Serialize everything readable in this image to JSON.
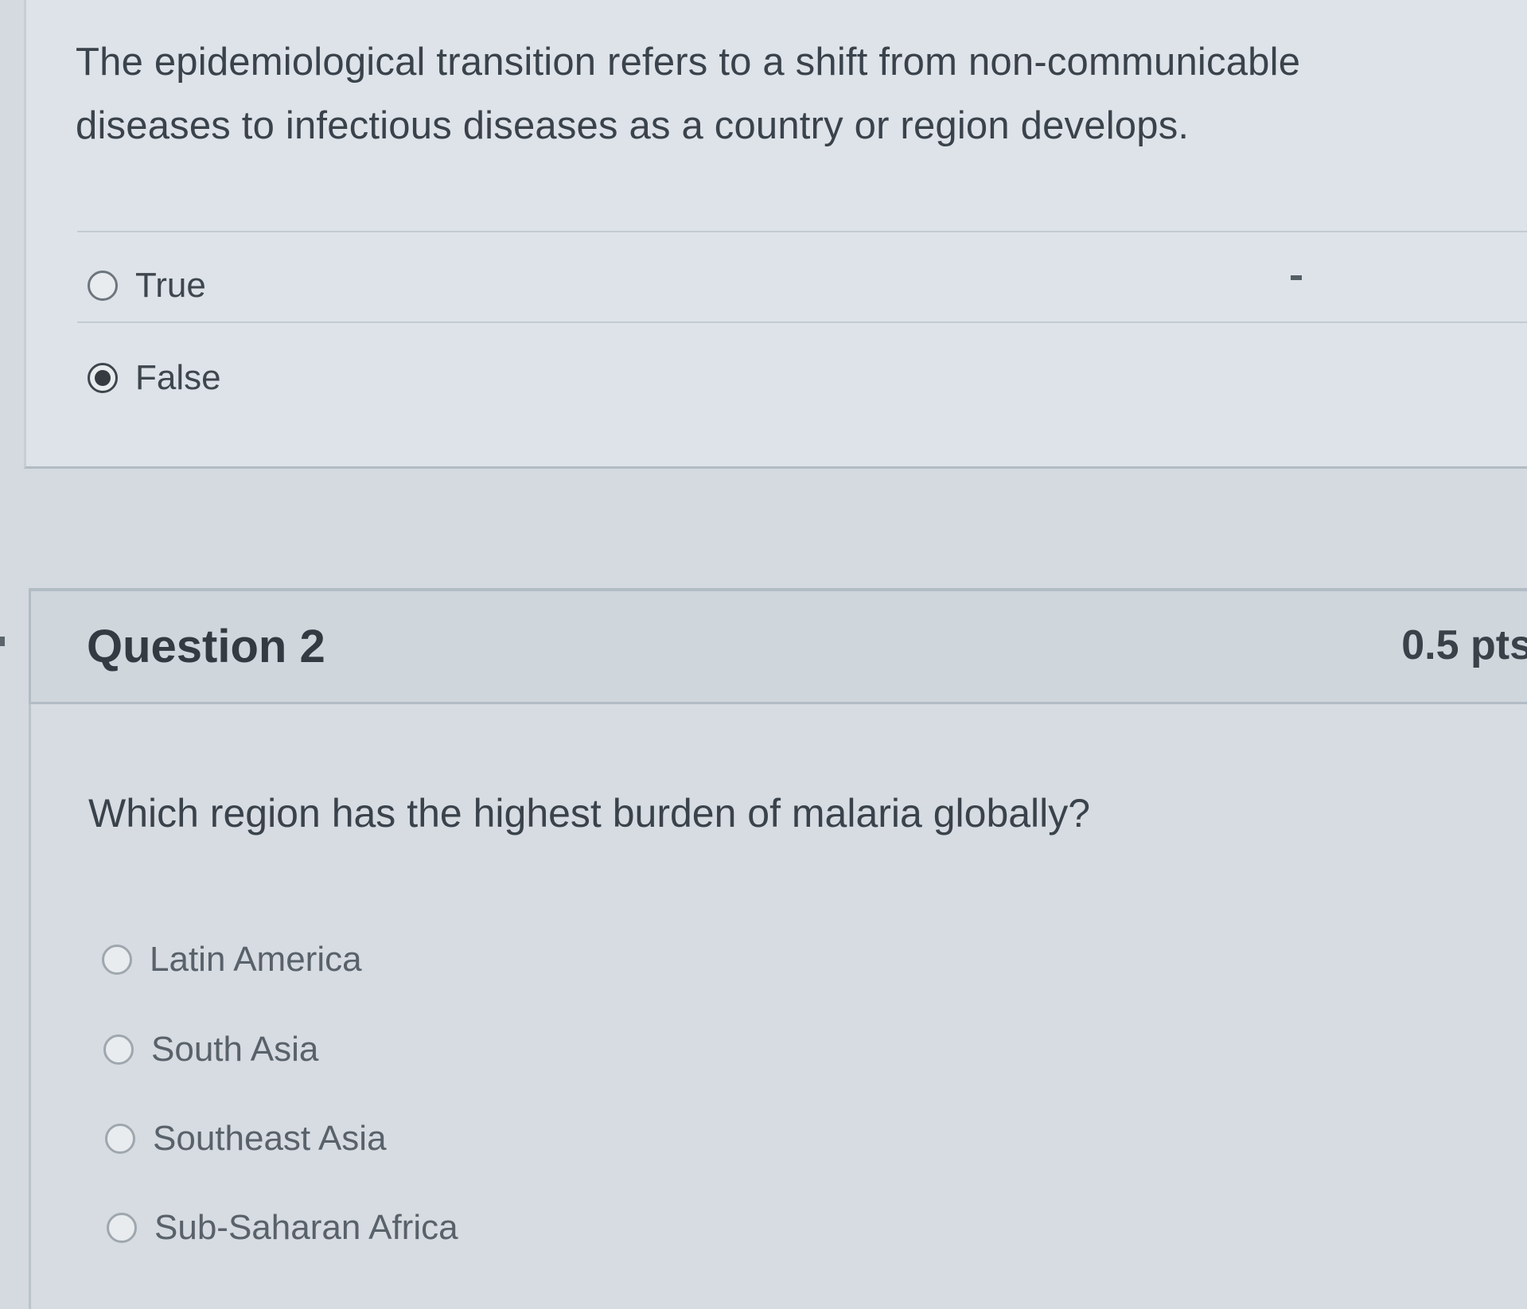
{
  "question1": {
    "text": "The epidemiological transition refers to a shift from non-communicable diseases to infectious diseases as a country or region develops.",
    "answers": [
      {
        "label": "True",
        "selected": false
      },
      {
        "label": "False",
        "selected": true
      }
    ]
  },
  "question2": {
    "title": "Question 2",
    "points": "0.5 pts",
    "text": "Which region has the highest burden of malaria globally?",
    "answers": [
      {
        "label": "Latin America",
        "selected": false
      },
      {
        "label": "South Asia",
        "selected": false
      },
      {
        "label": "Southeast Asia",
        "selected": false
      },
      {
        "label": "Sub-Saharan Africa",
        "selected": false
      }
    ]
  },
  "colors": {
    "page_background": "#d4dadf",
    "header_background": "#cfd6dc",
    "text": "#38414a"
  },
  "icons": {
    "radio_unselected": "radio-empty-circle",
    "radio_selected": "radio-filled-dot"
  }
}
